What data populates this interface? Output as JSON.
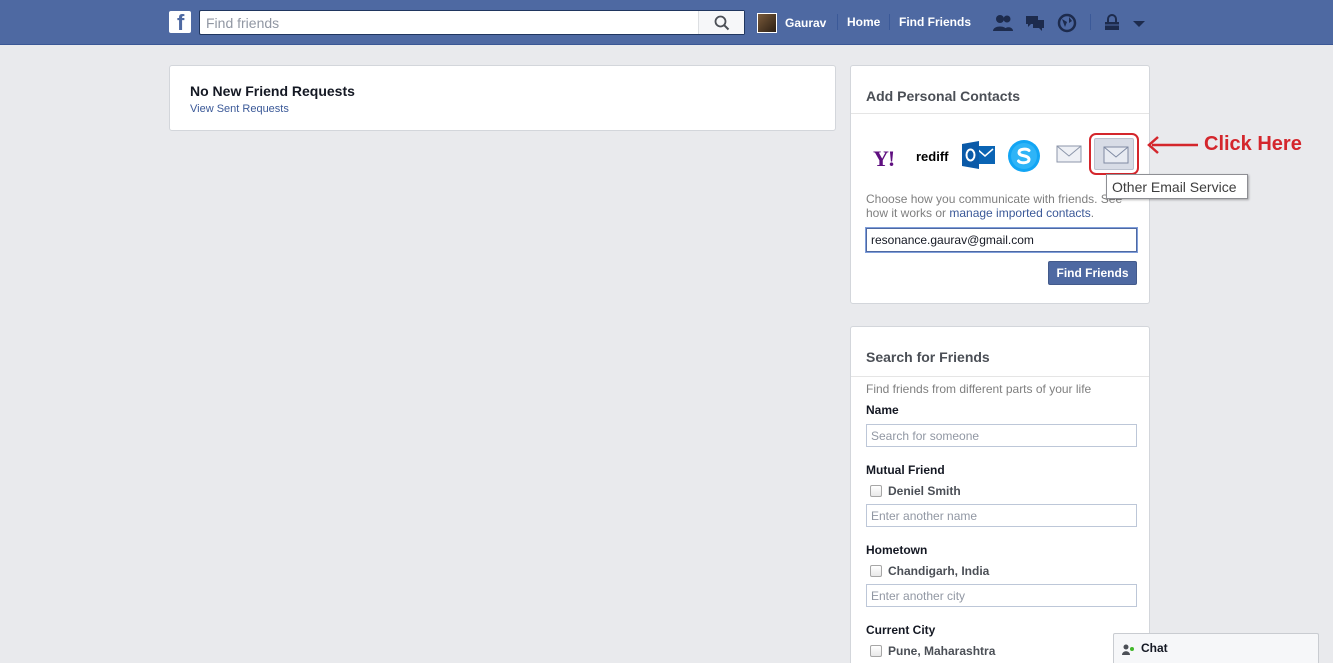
{
  "topbar": {
    "logo_letter": "f",
    "search_placeholder": "Find friends",
    "user_name": "Gaurav",
    "home_label": "Home",
    "find_friends_label": "Find Friends"
  },
  "requests": {
    "title": "No New Friend Requests",
    "link": "View Sent Requests"
  },
  "contacts": {
    "title": "Add Personal Contacts",
    "providers": {
      "yahoo": "Y!",
      "rediff": "rediff"
    },
    "tooltip": "Other Email Service",
    "description_prefix": "Choose how you communicate with friends. See how it works or ",
    "description_link": "manage imported contacts",
    "description_suffix": ".",
    "email_value": "resonance.gaurav@gmail.com",
    "button": "Find Friends"
  },
  "annotation": {
    "text": "Click Here"
  },
  "search": {
    "title": "Search for Friends",
    "subtitle": "Find friends from different parts of your life",
    "name_label": "Name",
    "name_placeholder": "Search for someone",
    "mutual_label": "Mutual Friend",
    "mutual_check": "Deniel Smith",
    "mutual_placeholder": "Enter another name",
    "hometown_label": "Hometown",
    "hometown_check": "Chandigarh, India",
    "hometown_placeholder": "Enter another city",
    "city_label": "Current City",
    "city_check": "Pune, Maharashtra"
  },
  "chat": {
    "label": "Chat"
  },
  "colors": {
    "brand_blue": "#4e69a2",
    "annotation_red": "#d4262c",
    "link_blue": "#3b5998"
  }
}
